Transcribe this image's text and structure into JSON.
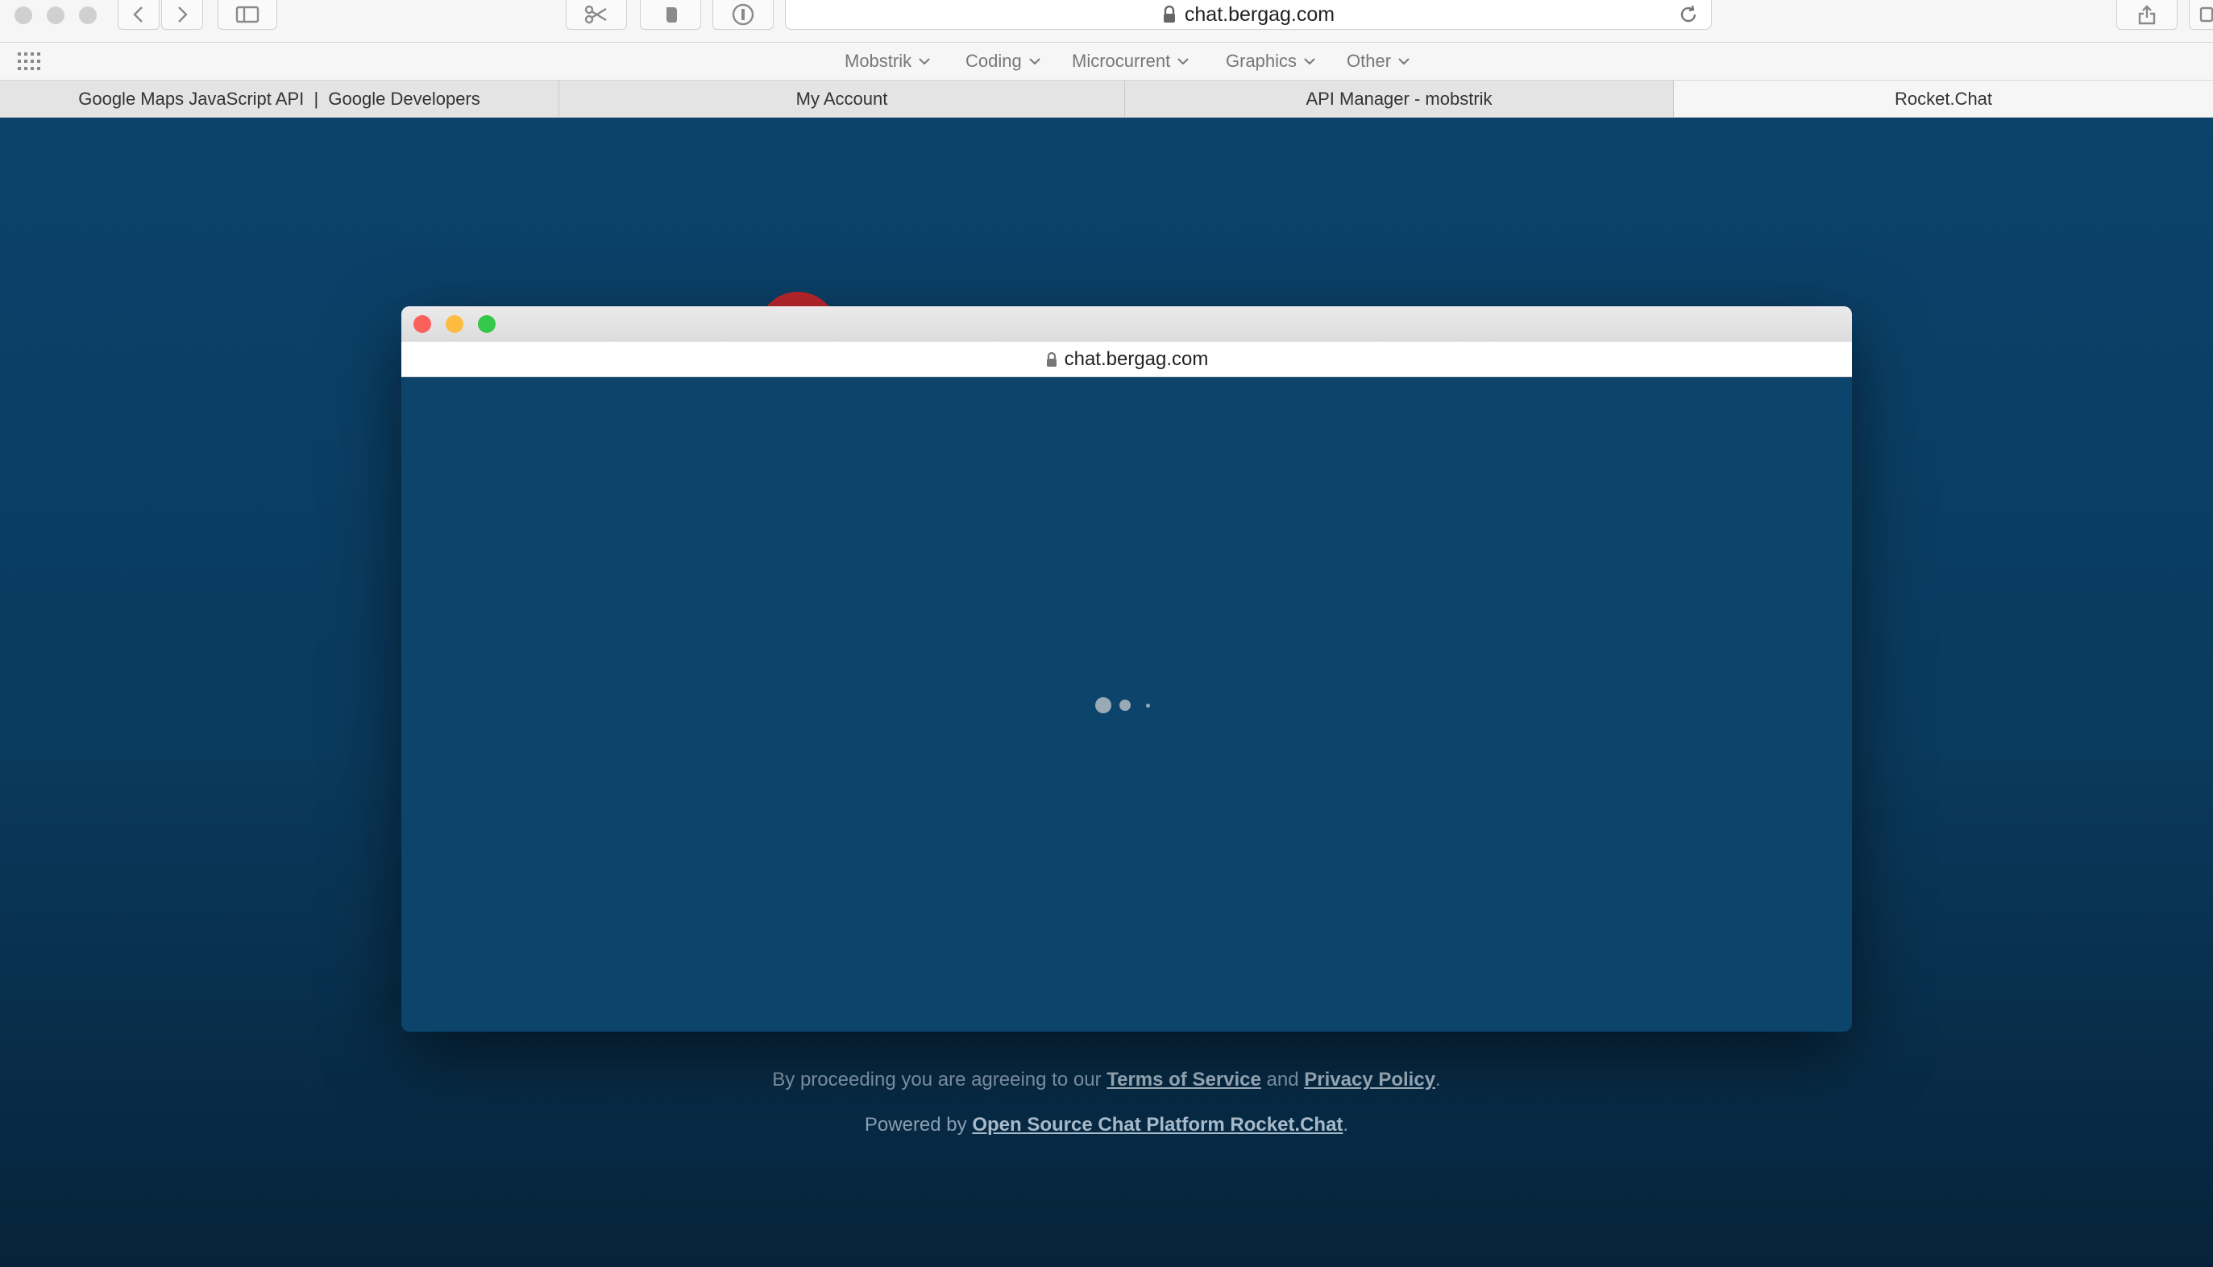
{
  "browser": {
    "url": "chat.bergag.com",
    "favorites": [
      {
        "label": "Mobstrik"
      },
      {
        "label": "Coding"
      },
      {
        "label": "Microcurrent"
      },
      {
        "label": "Graphics"
      },
      {
        "label": "Other"
      }
    ],
    "tabs": [
      {
        "label": "Google Maps JavaScript API  |  Google Developers"
      },
      {
        "label": "My Account"
      },
      {
        "label": "API Manager - mobstrik"
      },
      {
        "label": "Rocket.Chat"
      }
    ]
  },
  "popup": {
    "url": "chat.bergag.com"
  },
  "footer": {
    "agree_prefix": "By proceeding you are agreeing to our",
    "terms_link": "Terms of Service",
    "and_word": "and",
    "privacy_link": "Privacy Policy",
    "period": ".",
    "powered_prefix": "Powered by",
    "powered_link": "Open Source Chat Platform Rocket.Chat",
    "powered_period": "."
  },
  "colors": {
    "page_background": "#0b436c",
    "popup_background": "#0c446b",
    "close_light": "#fc605c",
    "minimize_light": "#fdbc40",
    "zoom_light": "#34c84a",
    "rocket_red": "#c1272d"
  }
}
